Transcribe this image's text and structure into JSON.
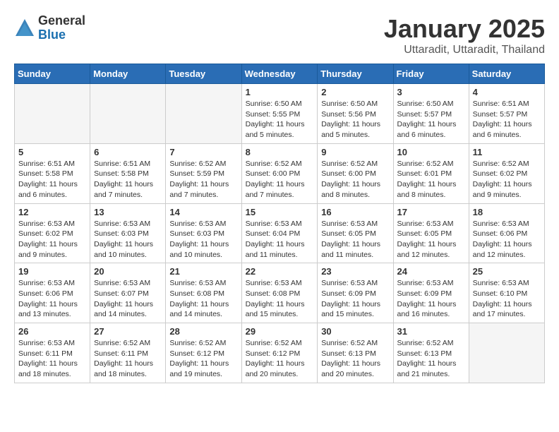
{
  "logo": {
    "general": "General",
    "blue": "Blue"
  },
  "header": {
    "month": "January 2025",
    "location": "Uttaradit, Uttaradit, Thailand"
  },
  "weekdays": [
    "Sunday",
    "Monday",
    "Tuesday",
    "Wednesday",
    "Thursday",
    "Friday",
    "Saturday"
  ],
  "weeks": [
    [
      {
        "day": "",
        "info": ""
      },
      {
        "day": "",
        "info": ""
      },
      {
        "day": "",
        "info": ""
      },
      {
        "day": "1",
        "info": "Sunrise: 6:50 AM\nSunset: 5:55 PM\nDaylight: 11 hours\nand 5 minutes."
      },
      {
        "day": "2",
        "info": "Sunrise: 6:50 AM\nSunset: 5:56 PM\nDaylight: 11 hours\nand 5 minutes."
      },
      {
        "day": "3",
        "info": "Sunrise: 6:50 AM\nSunset: 5:57 PM\nDaylight: 11 hours\nand 6 minutes."
      },
      {
        "day": "4",
        "info": "Sunrise: 6:51 AM\nSunset: 5:57 PM\nDaylight: 11 hours\nand 6 minutes."
      }
    ],
    [
      {
        "day": "5",
        "info": "Sunrise: 6:51 AM\nSunset: 5:58 PM\nDaylight: 11 hours\nand 6 minutes."
      },
      {
        "day": "6",
        "info": "Sunrise: 6:51 AM\nSunset: 5:58 PM\nDaylight: 11 hours\nand 7 minutes."
      },
      {
        "day": "7",
        "info": "Sunrise: 6:52 AM\nSunset: 5:59 PM\nDaylight: 11 hours\nand 7 minutes."
      },
      {
        "day": "8",
        "info": "Sunrise: 6:52 AM\nSunset: 6:00 PM\nDaylight: 11 hours\nand 7 minutes."
      },
      {
        "day": "9",
        "info": "Sunrise: 6:52 AM\nSunset: 6:00 PM\nDaylight: 11 hours\nand 8 minutes."
      },
      {
        "day": "10",
        "info": "Sunrise: 6:52 AM\nSunset: 6:01 PM\nDaylight: 11 hours\nand 8 minutes."
      },
      {
        "day": "11",
        "info": "Sunrise: 6:52 AM\nSunset: 6:02 PM\nDaylight: 11 hours\nand 9 minutes."
      }
    ],
    [
      {
        "day": "12",
        "info": "Sunrise: 6:53 AM\nSunset: 6:02 PM\nDaylight: 11 hours\nand 9 minutes."
      },
      {
        "day": "13",
        "info": "Sunrise: 6:53 AM\nSunset: 6:03 PM\nDaylight: 11 hours\nand 10 minutes."
      },
      {
        "day": "14",
        "info": "Sunrise: 6:53 AM\nSunset: 6:03 PM\nDaylight: 11 hours\nand 10 minutes."
      },
      {
        "day": "15",
        "info": "Sunrise: 6:53 AM\nSunset: 6:04 PM\nDaylight: 11 hours\nand 11 minutes."
      },
      {
        "day": "16",
        "info": "Sunrise: 6:53 AM\nSunset: 6:05 PM\nDaylight: 11 hours\nand 11 minutes."
      },
      {
        "day": "17",
        "info": "Sunrise: 6:53 AM\nSunset: 6:05 PM\nDaylight: 11 hours\nand 12 minutes."
      },
      {
        "day": "18",
        "info": "Sunrise: 6:53 AM\nSunset: 6:06 PM\nDaylight: 11 hours\nand 12 minutes."
      }
    ],
    [
      {
        "day": "19",
        "info": "Sunrise: 6:53 AM\nSunset: 6:06 PM\nDaylight: 11 hours\nand 13 minutes."
      },
      {
        "day": "20",
        "info": "Sunrise: 6:53 AM\nSunset: 6:07 PM\nDaylight: 11 hours\nand 14 minutes."
      },
      {
        "day": "21",
        "info": "Sunrise: 6:53 AM\nSunset: 6:08 PM\nDaylight: 11 hours\nand 14 minutes."
      },
      {
        "day": "22",
        "info": "Sunrise: 6:53 AM\nSunset: 6:08 PM\nDaylight: 11 hours\nand 15 minutes."
      },
      {
        "day": "23",
        "info": "Sunrise: 6:53 AM\nSunset: 6:09 PM\nDaylight: 11 hours\nand 15 minutes."
      },
      {
        "day": "24",
        "info": "Sunrise: 6:53 AM\nSunset: 6:09 PM\nDaylight: 11 hours\nand 16 minutes."
      },
      {
        "day": "25",
        "info": "Sunrise: 6:53 AM\nSunset: 6:10 PM\nDaylight: 11 hours\nand 17 minutes."
      }
    ],
    [
      {
        "day": "26",
        "info": "Sunrise: 6:53 AM\nSunset: 6:11 PM\nDaylight: 11 hours\nand 18 minutes."
      },
      {
        "day": "27",
        "info": "Sunrise: 6:52 AM\nSunset: 6:11 PM\nDaylight: 11 hours\nand 18 minutes."
      },
      {
        "day": "28",
        "info": "Sunrise: 6:52 AM\nSunset: 6:12 PM\nDaylight: 11 hours\nand 19 minutes."
      },
      {
        "day": "29",
        "info": "Sunrise: 6:52 AM\nSunset: 6:12 PM\nDaylight: 11 hours\nand 20 minutes."
      },
      {
        "day": "30",
        "info": "Sunrise: 6:52 AM\nSunset: 6:13 PM\nDaylight: 11 hours\nand 20 minutes."
      },
      {
        "day": "31",
        "info": "Sunrise: 6:52 AM\nSunset: 6:13 PM\nDaylight: 11 hours\nand 21 minutes."
      },
      {
        "day": "",
        "info": ""
      }
    ]
  ]
}
